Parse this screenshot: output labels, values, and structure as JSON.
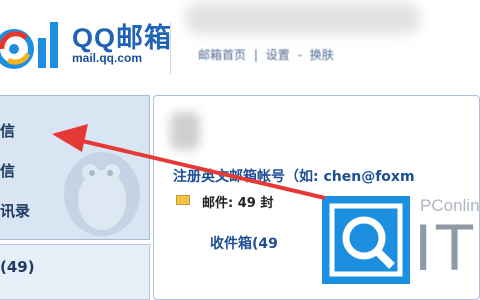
{
  "header": {
    "logo_text": "QQ邮箱",
    "logo_url": "mail.qq.com",
    "links": [
      "邮箱首页",
      "|",
      "设置",
      "-",
      "换肤"
    ]
  },
  "nav": {
    "items": [
      {
        "label": "信"
      },
      {
        "label": "信"
      },
      {
        "label": "讯录"
      }
    ],
    "folder_count": "(49)"
  },
  "content": {
    "register_text": "注册英文邮箱帐号（如: chen@foxm",
    "mail_count": "邮件: 49 封",
    "inbox_link": "收件箱(49"
  },
  "watermark": {
    "brand_small": "PConlin",
    "brand_big": "IT",
    "color": "#1d8fe0"
  },
  "colors": {
    "accent": "#1e63b5",
    "nav_bg": "#d9e5f2",
    "arrow": "#e53935"
  }
}
